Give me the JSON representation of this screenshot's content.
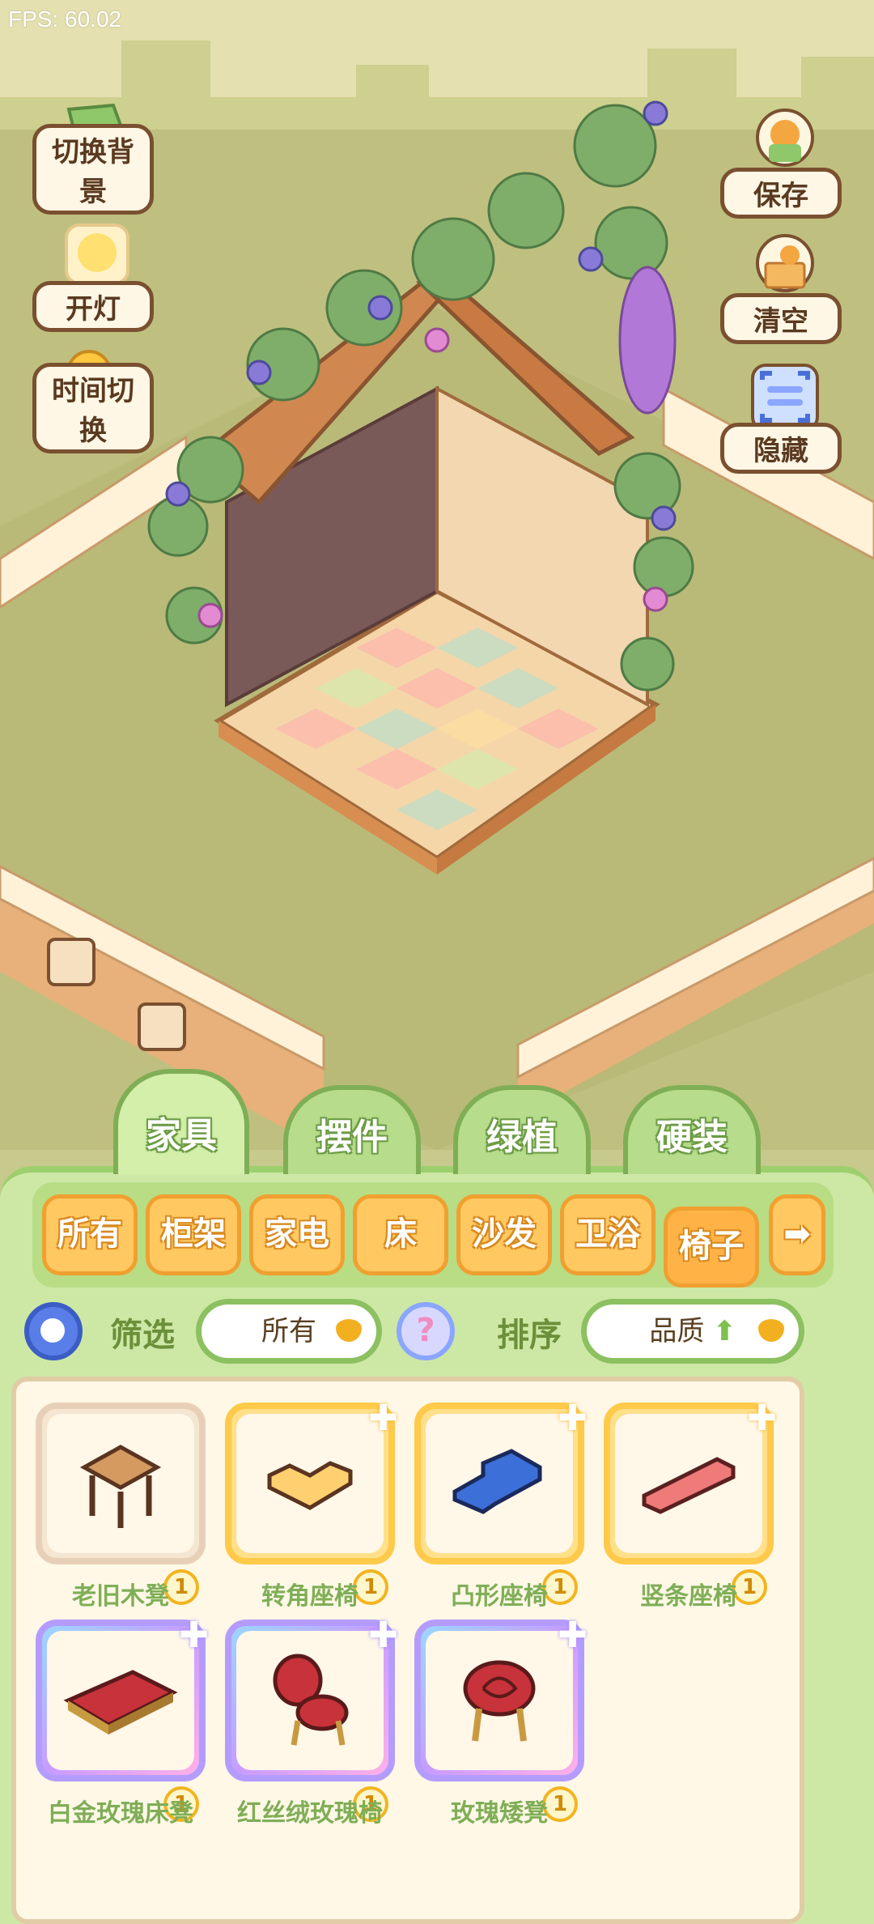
{
  "hud": {
    "fps": "FPS: 60.02"
  },
  "left_buttons": [
    {
      "label": "切换背景",
      "icon": "background-swap-icon"
    },
    {
      "label": "开灯",
      "icon": "lamp-icon"
    },
    {
      "label": "时间切换",
      "icon": "sun-moon-icon"
    }
  ],
  "right_buttons": [
    {
      "label": "保存",
      "icon": "save-icon"
    },
    {
      "label": "清空",
      "icon": "clear-icon"
    },
    {
      "label": "隐藏",
      "icon": "hide-icon"
    }
  ],
  "category_tabs": [
    {
      "label": "家具",
      "active": true
    },
    {
      "label": "摆件",
      "active": false
    },
    {
      "label": "绿植",
      "active": false
    },
    {
      "label": "硬装",
      "active": false
    }
  ],
  "sub_tabs": [
    {
      "label": "所有"
    },
    {
      "label": "柜架"
    },
    {
      "label": "家电"
    },
    {
      "label": "床"
    },
    {
      "label": "沙发"
    },
    {
      "label": "卫浴"
    },
    {
      "label": "椅子",
      "active": true
    }
  ],
  "filter": {
    "filter_label": "筛选",
    "filter_value": "所有",
    "help_glyph": "?",
    "sort_label": "排序",
    "sort_value": "品质",
    "sort_arrow": "⬆"
  },
  "items": [
    {
      "name": "老旧木凳",
      "count": "1",
      "quality": "common"
    },
    {
      "name": "转角座椅",
      "count": "1",
      "quality": "gold"
    },
    {
      "name": "凸形座椅",
      "count": "1",
      "quality": "gold"
    },
    {
      "name": "竖条座椅",
      "count": "1",
      "quality": "gold"
    },
    {
      "name": "白金玫瑰床凳",
      "count": "1",
      "quality": "purple"
    },
    {
      "name": "红丝绒玫瑰椅",
      "count": "1",
      "quality": "purple"
    },
    {
      "name": "玫瑰矮凳",
      "count": "1",
      "quality": "purple"
    }
  ],
  "colors": {
    "background": "#c8c98c",
    "panel": "#cde8a5",
    "tab_green": "#b7dd8c",
    "subtab_orange": "#ffc860",
    "label_green": "#7fae57"
  }
}
